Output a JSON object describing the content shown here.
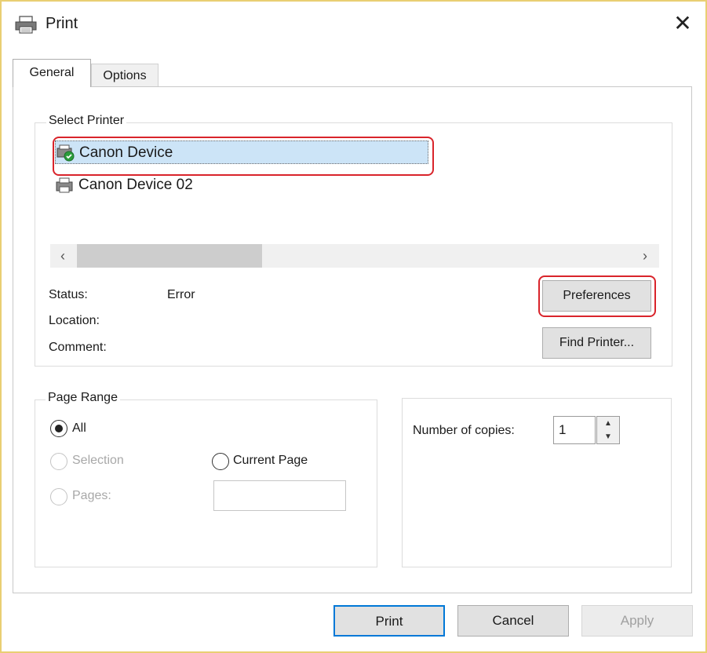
{
  "window": {
    "title": "Print",
    "close_glyph": "✕"
  },
  "tabs": [
    {
      "label": "General",
      "active": true
    },
    {
      "label": "Options",
      "active": false
    }
  ],
  "select_printer": {
    "legend": "Select Printer",
    "printers": [
      {
        "name": "Canon Device",
        "selected": true,
        "icon": "default-printer-icon"
      },
      {
        "name": "Canon Device 02",
        "selected": false,
        "icon": "printer-icon"
      }
    ],
    "scroll_left": "‹",
    "scroll_right": "›",
    "status_label": "Status:",
    "status_value": "Error",
    "location_label": "Location:",
    "comment_label": "Comment:",
    "preferences_label": "Preferences",
    "find_printer_label": "Find Printer..."
  },
  "page_range": {
    "legend": "Page Range",
    "all_label": "All",
    "selection_label": "Selection",
    "current_page_label": "Current Page",
    "pages_label": "Pages:",
    "selected": "All",
    "pages_value": ""
  },
  "copies": {
    "label": "Number of copies:",
    "value": "1"
  },
  "footer": {
    "print_label": "Print",
    "cancel_label": "Cancel",
    "apply_label": "Apply"
  },
  "colors": {
    "selection_bg": "#cce4f7",
    "highlight_ring": "#d9242b",
    "frame": "#e9cf73",
    "default_button_border": "#0078d7"
  }
}
